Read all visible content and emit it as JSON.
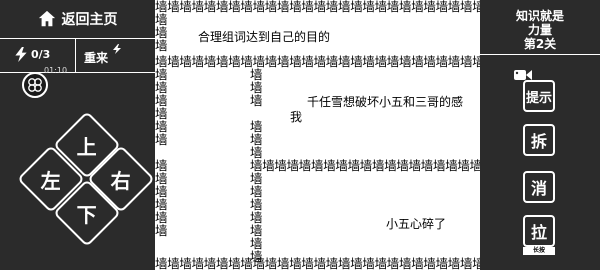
{
  "left_panel": {
    "home_label": "返回主页",
    "energy": "0/3",
    "timer": "01:10",
    "retry_label": "重来"
  },
  "dpad": {
    "up": "上",
    "left": "左",
    "right": "右",
    "down": "下"
  },
  "maze": {
    "wall_char": "墙",
    "texts": {
      "clue1": "合理组词达到自己的目的",
      "clue2_line1": "千任雪想破坏小五和三哥的感",
      "clue2_line2": "我",
      "clue3": "小五心碎了"
    }
  },
  "right_panel": {
    "level_line1": "知识就是",
    "level_line2": "力量",
    "level_line3": "第2关",
    "tools": {
      "hint": "提示",
      "split": "拆",
      "remove": "消",
      "pull": "拉",
      "pull_sub": "长按"
    }
  },
  "colors": {
    "panel_bg": "#2b2b2b",
    "maze_bg": "#ffffff",
    "text_light": "#ffffff",
    "wall_text": "#000000"
  }
}
